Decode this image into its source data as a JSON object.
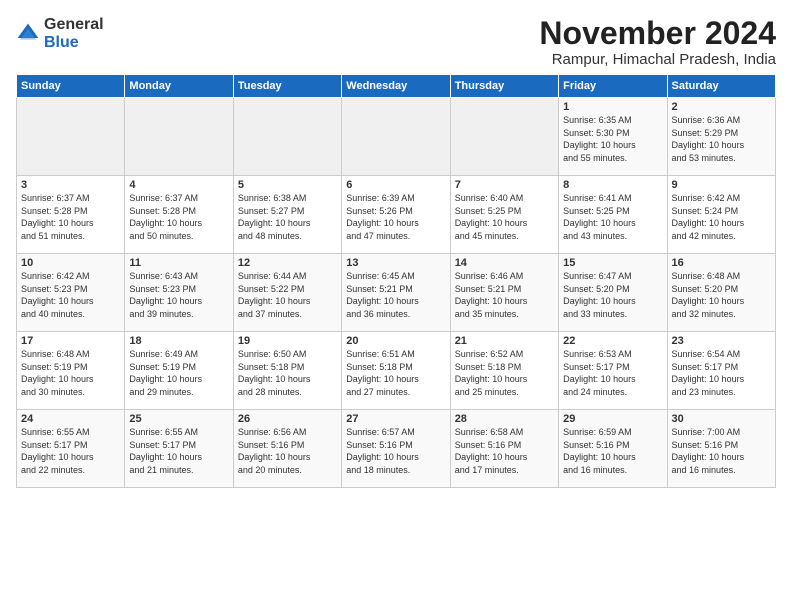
{
  "logo": {
    "general": "General",
    "blue": "Blue"
  },
  "title": "November 2024",
  "subtitle": "Rampur, Himachal Pradesh, India",
  "days_of_week": [
    "Sunday",
    "Monday",
    "Tuesday",
    "Wednesday",
    "Thursday",
    "Friday",
    "Saturday"
  ],
  "weeks": [
    [
      {
        "day": "",
        "info": ""
      },
      {
        "day": "",
        "info": ""
      },
      {
        "day": "",
        "info": ""
      },
      {
        "day": "",
        "info": ""
      },
      {
        "day": "",
        "info": ""
      },
      {
        "day": "1",
        "info": "Sunrise: 6:35 AM\nSunset: 5:30 PM\nDaylight: 10 hours\nand 55 minutes."
      },
      {
        "day": "2",
        "info": "Sunrise: 6:36 AM\nSunset: 5:29 PM\nDaylight: 10 hours\nand 53 minutes."
      }
    ],
    [
      {
        "day": "3",
        "info": "Sunrise: 6:37 AM\nSunset: 5:28 PM\nDaylight: 10 hours\nand 51 minutes."
      },
      {
        "day": "4",
        "info": "Sunrise: 6:37 AM\nSunset: 5:28 PM\nDaylight: 10 hours\nand 50 minutes."
      },
      {
        "day": "5",
        "info": "Sunrise: 6:38 AM\nSunset: 5:27 PM\nDaylight: 10 hours\nand 48 minutes."
      },
      {
        "day": "6",
        "info": "Sunrise: 6:39 AM\nSunset: 5:26 PM\nDaylight: 10 hours\nand 47 minutes."
      },
      {
        "day": "7",
        "info": "Sunrise: 6:40 AM\nSunset: 5:25 PM\nDaylight: 10 hours\nand 45 minutes."
      },
      {
        "day": "8",
        "info": "Sunrise: 6:41 AM\nSunset: 5:25 PM\nDaylight: 10 hours\nand 43 minutes."
      },
      {
        "day": "9",
        "info": "Sunrise: 6:42 AM\nSunset: 5:24 PM\nDaylight: 10 hours\nand 42 minutes."
      }
    ],
    [
      {
        "day": "10",
        "info": "Sunrise: 6:42 AM\nSunset: 5:23 PM\nDaylight: 10 hours\nand 40 minutes."
      },
      {
        "day": "11",
        "info": "Sunrise: 6:43 AM\nSunset: 5:23 PM\nDaylight: 10 hours\nand 39 minutes."
      },
      {
        "day": "12",
        "info": "Sunrise: 6:44 AM\nSunset: 5:22 PM\nDaylight: 10 hours\nand 37 minutes."
      },
      {
        "day": "13",
        "info": "Sunrise: 6:45 AM\nSunset: 5:21 PM\nDaylight: 10 hours\nand 36 minutes."
      },
      {
        "day": "14",
        "info": "Sunrise: 6:46 AM\nSunset: 5:21 PM\nDaylight: 10 hours\nand 35 minutes."
      },
      {
        "day": "15",
        "info": "Sunrise: 6:47 AM\nSunset: 5:20 PM\nDaylight: 10 hours\nand 33 minutes."
      },
      {
        "day": "16",
        "info": "Sunrise: 6:48 AM\nSunset: 5:20 PM\nDaylight: 10 hours\nand 32 minutes."
      }
    ],
    [
      {
        "day": "17",
        "info": "Sunrise: 6:48 AM\nSunset: 5:19 PM\nDaylight: 10 hours\nand 30 minutes."
      },
      {
        "day": "18",
        "info": "Sunrise: 6:49 AM\nSunset: 5:19 PM\nDaylight: 10 hours\nand 29 minutes."
      },
      {
        "day": "19",
        "info": "Sunrise: 6:50 AM\nSunset: 5:18 PM\nDaylight: 10 hours\nand 28 minutes."
      },
      {
        "day": "20",
        "info": "Sunrise: 6:51 AM\nSunset: 5:18 PM\nDaylight: 10 hours\nand 27 minutes."
      },
      {
        "day": "21",
        "info": "Sunrise: 6:52 AM\nSunset: 5:18 PM\nDaylight: 10 hours\nand 25 minutes."
      },
      {
        "day": "22",
        "info": "Sunrise: 6:53 AM\nSunset: 5:17 PM\nDaylight: 10 hours\nand 24 minutes."
      },
      {
        "day": "23",
        "info": "Sunrise: 6:54 AM\nSunset: 5:17 PM\nDaylight: 10 hours\nand 23 minutes."
      }
    ],
    [
      {
        "day": "24",
        "info": "Sunrise: 6:55 AM\nSunset: 5:17 PM\nDaylight: 10 hours\nand 22 minutes."
      },
      {
        "day": "25",
        "info": "Sunrise: 6:55 AM\nSunset: 5:17 PM\nDaylight: 10 hours\nand 21 minutes."
      },
      {
        "day": "26",
        "info": "Sunrise: 6:56 AM\nSunset: 5:16 PM\nDaylight: 10 hours\nand 20 minutes."
      },
      {
        "day": "27",
        "info": "Sunrise: 6:57 AM\nSunset: 5:16 PM\nDaylight: 10 hours\nand 18 minutes."
      },
      {
        "day": "28",
        "info": "Sunrise: 6:58 AM\nSunset: 5:16 PM\nDaylight: 10 hours\nand 17 minutes."
      },
      {
        "day": "29",
        "info": "Sunrise: 6:59 AM\nSunset: 5:16 PM\nDaylight: 10 hours\nand 16 minutes."
      },
      {
        "day": "30",
        "info": "Sunrise: 7:00 AM\nSunset: 5:16 PM\nDaylight: 10 hours\nand 16 minutes."
      }
    ]
  ]
}
